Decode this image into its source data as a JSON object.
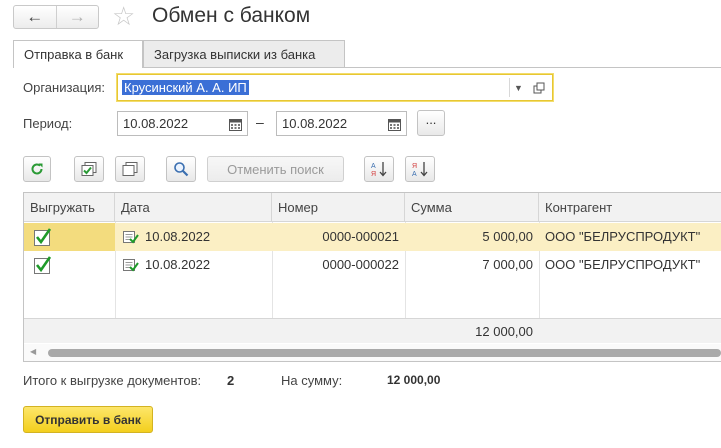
{
  "window": {
    "title": "Обмен с банком"
  },
  "nav": {
    "back_icon": "←",
    "forward_icon": "→",
    "favorite_icon": "☆"
  },
  "tabs": [
    {
      "label": "Отправка в банк",
      "active": true
    },
    {
      "label": "Загрузка выписки из банка",
      "active": false
    }
  ],
  "form": {
    "organization_label": "Организация:",
    "organization_value": "Крусинский А. А. ИП",
    "period_label": "Период:",
    "date_from": "10.08.2022",
    "date_separator": "–",
    "date_to": "10.08.2022",
    "period_choose_label": "..."
  },
  "toolbar": {
    "cancel_search_label": "Отменить поиск"
  },
  "table": {
    "columns": [
      "Выгружать",
      "Дата",
      "Номер",
      "Сумма",
      "Контрагент"
    ],
    "rows": [
      {
        "export": true,
        "date": "10.08.2022",
        "number": "0000-000021",
        "amount": "5 000,00",
        "counterparty": "ООО \"БЕЛРУСПРОДУКТ\"",
        "selected": true
      },
      {
        "export": true,
        "date": "10.08.2022",
        "number": "0000-000022",
        "amount": "7 000,00",
        "counterparty": "ООО \"БЕЛРУСПРОДУКТ\"",
        "selected": false
      }
    ],
    "footer_total": "12 000,00"
  },
  "totals": {
    "count_label": "Итого к выгрузке документов:",
    "count_value": "2",
    "sum_label": "На сумму:",
    "sum_value": "12 000,00"
  },
  "actions": {
    "send_label": "Отправить в банк"
  },
  "colors": {
    "accent_yellow": "#f3cf1d",
    "selection_blue": "#3b6fd6",
    "selected_row": "#fbefc4",
    "check_green": "#1f9a2a"
  }
}
